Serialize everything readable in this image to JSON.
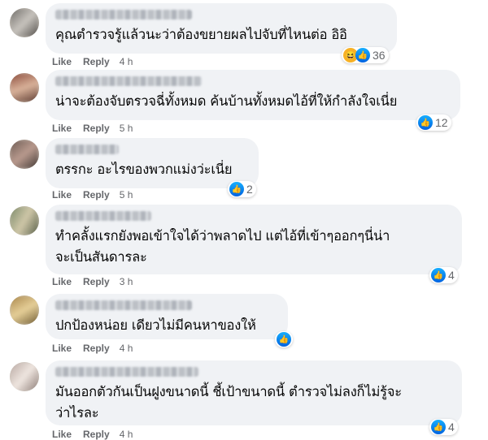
{
  "actions": {
    "like": "Like",
    "reply": "Reply"
  },
  "comments": [
    {
      "text": "คุณตำรวจรู้แล้วนะว่าต้องขยายผลไปจับที่ไหนต่อ อิอิ",
      "time": "4 h",
      "reactions": [
        "haha",
        "like"
      ],
      "count": "36"
    },
    {
      "text": "น่าจะต้องจับตรวจฉี่ทั้งหมด ค้นบ้านทั้งหมดไอ้ที่ให้กำลังใจเนี่ย",
      "time": "5 h",
      "reactions": [
        "like"
      ],
      "count": "12"
    },
    {
      "text": "ตรรกะ อะไรของพวกแม่งว่ะเนี่ย",
      "time": "5 h",
      "reactions": [
        "like"
      ],
      "count": "2"
    },
    {
      "text": "ทำคลั้งแรกยังพอเข้าใจได้ว่าพลาดไป แต่ไอ้ที่เข้าๆออกๆนี่น่า\nจะเป็นสันดารละ",
      "time": "3 h",
      "reactions": [
        "like"
      ],
      "count": "4"
    },
    {
      "text": "ปกป้องหน่อย เดียวไม่มีคนหาของให้",
      "time": "4 h",
      "reactions": [
        "like"
      ],
      "count": ""
    },
    {
      "text": "มันออกตัวกันเป็นฝูงขนาดนี้ ชี้เป้าขนาดนี้ ตำรวจไม่ลงก็ไม่รู้จะ\nว่าไรละ",
      "time": "4 h",
      "reactions": [
        "like"
      ],
      "count": "4"
    }
  ],
  "colors": {
    "bubble": "#f0f2f5",
    "meta": "#65676b",
    "like_blue": "#1877f2"
  }
}
